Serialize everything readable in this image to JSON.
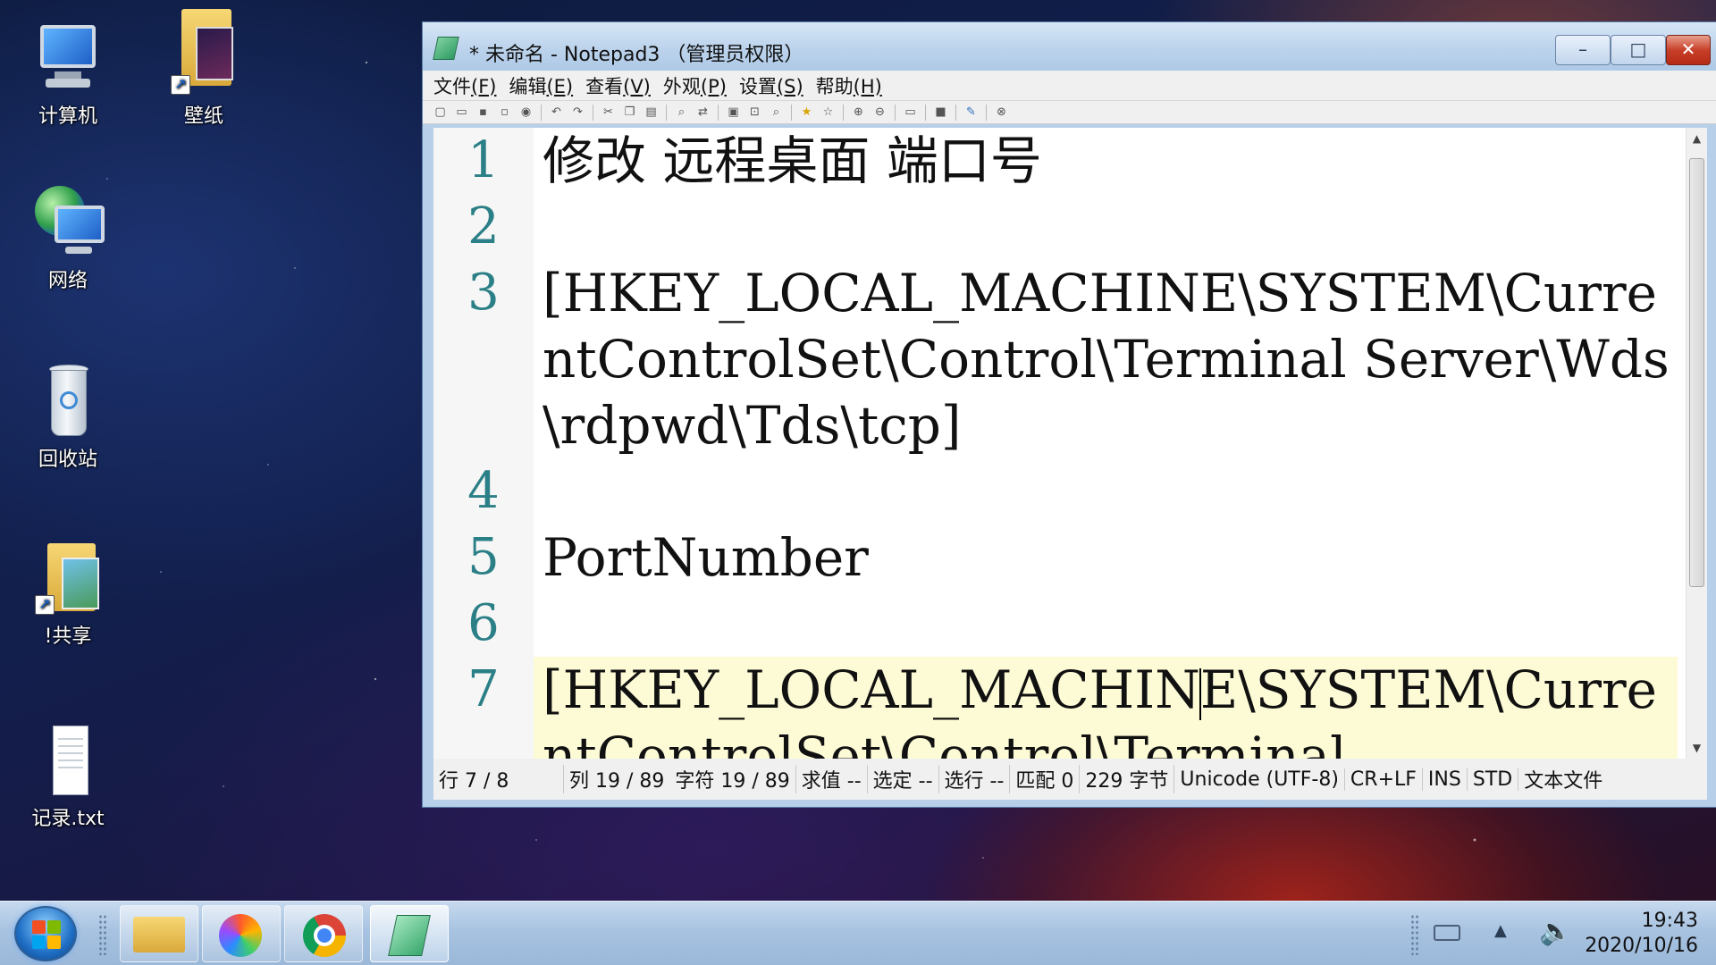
{
  "desktop": {
    "icons": [
      {
        "label": "计算机",
        "icon": "computer-icon"
      },
      {
        "label": "壁纸",
        "icon": "folder-shortcut-icon"
      },
      {
        "label": "网络",
        "icon": "network-icon"
      },
      {
        "label": "回收站",
        "icon": "recycle-bin-icon"
      },
      {
        "label": "!共享",
        "icon": "folder-shortcut-icon"
      },
      {
        "label": "记录.txt",
        "icon": "text-file-icon"
      }
    ]
  },
  "window": {
    "title": "* 未命名 - Notepad3 （管理员权限）",
    "buttons": {
      "minimize": "–",
      "maximize": "□",
      "close": "✕"
    },
    "menu": [
      {
        "label": "文件",
        "key": "(F)"
      },
      {
        "label": "编辑",
        "key": "(E)"
      },
      {
        "label": "查看",
        "key": "(V)"
      },
      {
        "label": "外观",
        "key": "(P)"
      },
      {
        "label": "设置",
        "key": "(S)"
      },
      {
        "label": "帮助",
        "key": "(H)"
      }
    ]
  },
  "editor": {
    "lines": [
      {
        "num": "1",
        "text": "修改 远程桌面 端口号"
      },
      {
        "num": "2",
        "text": ""
      },
      {
        "num": "3",
        "text": "[HKEY_LOCAL_MACHINE\\SYSTEM\\CurrentControlSet\\Control\\Terminal Server\\Wds\\rdpwd\\Tds\\tcp]"
      },
      {
        "num": "4",
        "text": ""
      },
      {
        "num": "5",
        "text": "PortNumber"
      },
      {
        "num": "6",
        "text": ""
      },
      {
        "num": "7",
        "text_before_caret": "[HKEY_LOCAL_MACHIN",
        "text_after_caret": "E\\SYSTEM\\CurrentControlSet\\Control\\Terminal"
      }
    ]
  },
  "status": {
    "line": "行  7 / 8",
    "col": "列  19 / 89",
    "chars": "字符  19 / 89",
    "calc": "求值  --",
    "sel": "选定  --",
    "sel_lines": "选行  --",
    "match": "匹配  0",
    "bytes": "229 字节",
    "encoding": "Unicode (UTF-8)",
    "eol": "CR+LF",
    "ins": "INS",
    "std": "STD",
    "type": "文本文件"
  },
  "taskbar": {
    "time": "19:43",
    "date": "2020/10/16"
  }
}
